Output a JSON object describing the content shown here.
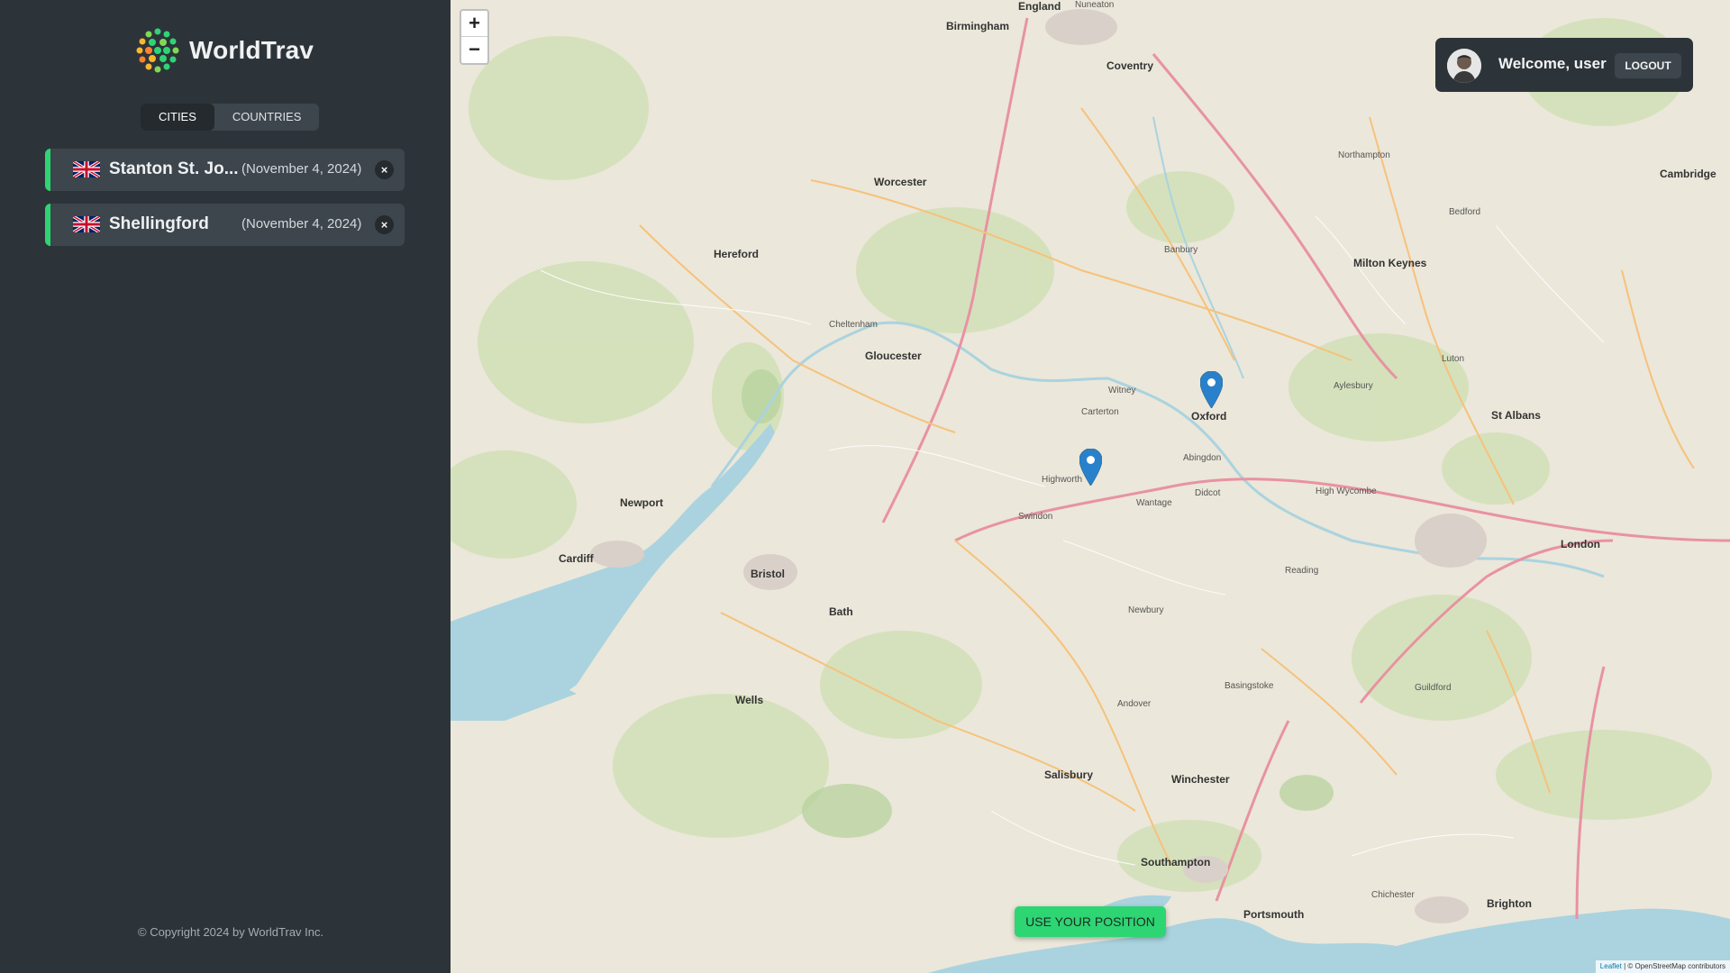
{
  "app": {
    "name": "WorldTrav"
  },
  "tabs": [
    {
      "label": "Cities",
      "active": true
    },
    {
      "label": "Countries",
      "active": false
    }
  ],
  "cities": [
    {
      "flag": "uk-flag",
      "name": "Stanton St. Jo...",
      "date": "(November 4, 2024)",
      "delete": "×"
    },
    {
      "flag": "uk-flag",
      "name": "Shellingford",
      "date": "(November 4, 2024)",
      "delete": "×"
    }
  ],
  "footer": {
    "copyright": "© Copyright 2024 by WorldTrav Inc."
  },
  "map": {
    "zoom_in": "+",
    "zoom_out": "−",
    "use_position": "Use your position",
    "attribution_leaflet": "Leaflet",
    "attribution_osm": "© OpenStreetMap contributors",
    "places": [
      "England",
      "Birmingham",
      "Coventry",
      "Nuneaton",
      "Worcester",
      "Hereford",
      "Gloucester",
      "Oxford",
      "Newport",
      "Cardiff",
      "Bristol",
      "Bath",
      "Swindon",
      "Milton Keynes",
      "Cambridge",
      "London",
      "Reading",
      "Salisbury",
      "Winchester",
      "Southampton",
      "Portsmouth",
      "Brighton",
      "Chichester",
      "Guildford",
      "Luton",
      "St Albans",
      "Northampton",
      "Banbury",
      "Newbury",
      "Wells",
      "Abingdon",
      "Didcot",
      "Highworth",
      "Wantage",
      "Carterton",
      "Witney",
      "Cheltenham",
      "Bedford",
      "Aylesbury",
      "High Wycombe",
      "Basingstoke",
      "Andover"
    ]
  },
  "user": {
    "welcome": "Welcome, user",
    "logout": "Logout"
  },
  "colors": {
    "brand_green": "#2ed573",
    "sidebar_bg": "#2d3439",
    "item_bg": "#3d464c",
    "pin_blue": "#2a81cb"
  }
}
